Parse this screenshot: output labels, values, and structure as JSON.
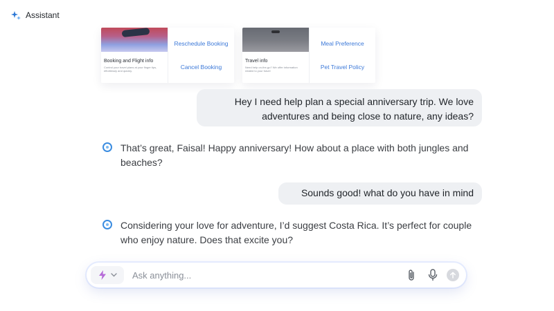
{
  "header": {
    "title": "Assistant",
    "icon": "sparkle-icon"
  },
  "cards": [
    {
      "title": "Booking and Flight info",
      "description": "Control your travel plans at your finger tips, effortlessly and quickly.",
      "links": [
        "Reschedule Booking",
        "Cancel Booking"
      ]
    },
    {
      "title": "Travel info",
      "description": "Need help on-the-go? We offer information related to your travel",
      "links": [
        "Meal Preference",
        "Pet Travel Policy"
      ]
    }
  ],
  "messages": {
    "user_1": "Hey I need help plan a special anniversary trip. We love adventures and being close to nature, any ideas?",
    "ai_1": "That’s great, Faisal! Happy anniversary! How about a place with both jungles and beaches?",
    "user_2": "Sounds good! what do you have in mind",
    "ai_2": "Considering your love for adventure, I’d suggest Costa Rica. It’s perfect for couple who enjoy nature. Does that excite you?"
  },
  "input": {
    "placeholder": "Ask anything...",
    "mode_icon": "lightning-icon",
    "icons": [
      "paperclip-icon",
      "microphone-icon",
      "send-arrow-icon"
    ]
  },
  "colors": {
    "link": "#3b78d8",
    "user_bubble": "#eef0f3",
    "avatar_ring": "#3a8ce0"
  }
}
